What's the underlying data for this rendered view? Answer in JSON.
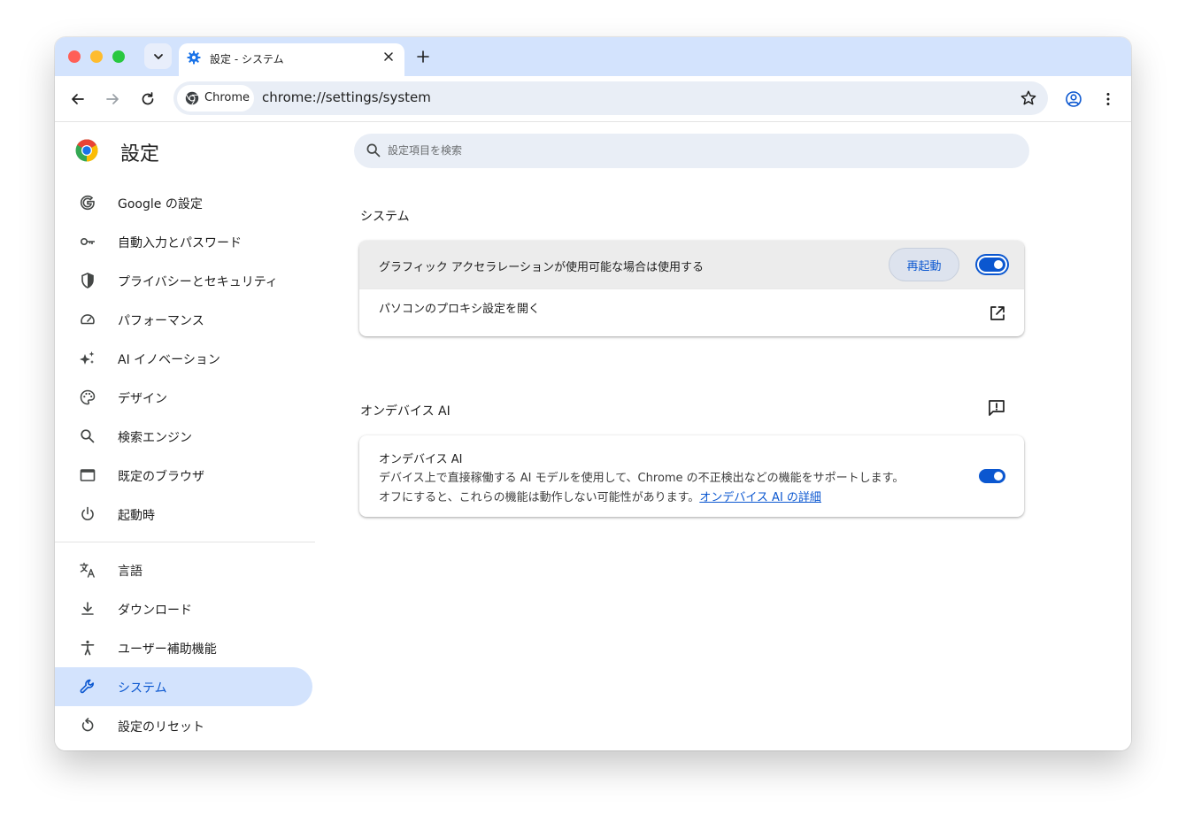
{
  "tab": {
    "title": "設定 - システム"
  },
  "omnibox": {
    "chip_label": "Chrome",
    "url": "chrome://settings/system"
  },
  "header": {
    "title": "設定"
  },
  "search": {
    "placeholder": "設定項目を検索"
  },
  "sidebar": {
    "items": [
      {
        "label": "Google の設定",
        "icon": "google-g-icon"
      },
      {
        "label": "自動入力とパスワード",
        "icon": "key-icon"
      },
      {
        "label": "プライバシーとセキュリティ",
        "icon": "shield-icon"
      },
      {
        "label": "パフォーマンス",
        "icon": "speedometer-icon"
      },
      {
        "label": "AI イノベーション",
        "icon": "sparkle-icon"
      },
      {
        "label": "デザイン",
        "icon": "palette-icon"
      },
      {
        "label": "検索エンジン",
        "icon": "search-icon"
      },
      {
        "label": "既定のブラウザ",
        "icon": "browser-window-icon"
      },
      {
        "label": "起動時",
        "icon": "power-icon"
      }
    ],
    "advanced_items": [
      {
        "label": "言語",
        "icon": "translate-icon"
      },
      {
        "label": "ダウンロード",
        "icon": "download-icon"
      },
      {
        "label": "ユーザー補助機能",
        "icon": "accessibility-icon"
      },
      {
        "label": "システム",
        "icon": "wrench-icon",
        "active": true
      },
      {
        "label": "設定のリセット",
        "icon": "reset-icon"
      }
    ]
  },
  "system_section": {
    "title": "システム",
    "graphics_label": "グラフィック アクセラレーションが使用可能な場合は使用する",
    "relaunch_label": "再起動",
    "graphics_enabled": true,
    "proxy_label": "パソコンのプロキシ設定を開く"
  },
  "ai_section": {
    "title": "オンデバイス AI",
    "card_title": "オンデバイス AI",
    "desc_line1": "デバイス上で直接稼働する AI モデルを使用して、Chrome の不正検出などの機能をサポートします。",
    "desc_line2": "オフにすると、これらの機能は動作しない可能性があります。",
    "link_label": "オンデバイス AI の詳細",
    "enabled": true
  },
  "colors": {
    "accent": "#0b57d0",
    "tabstrip": "#d3e3fd",
    "active_nav": "#d3e3fd"
  }
}
